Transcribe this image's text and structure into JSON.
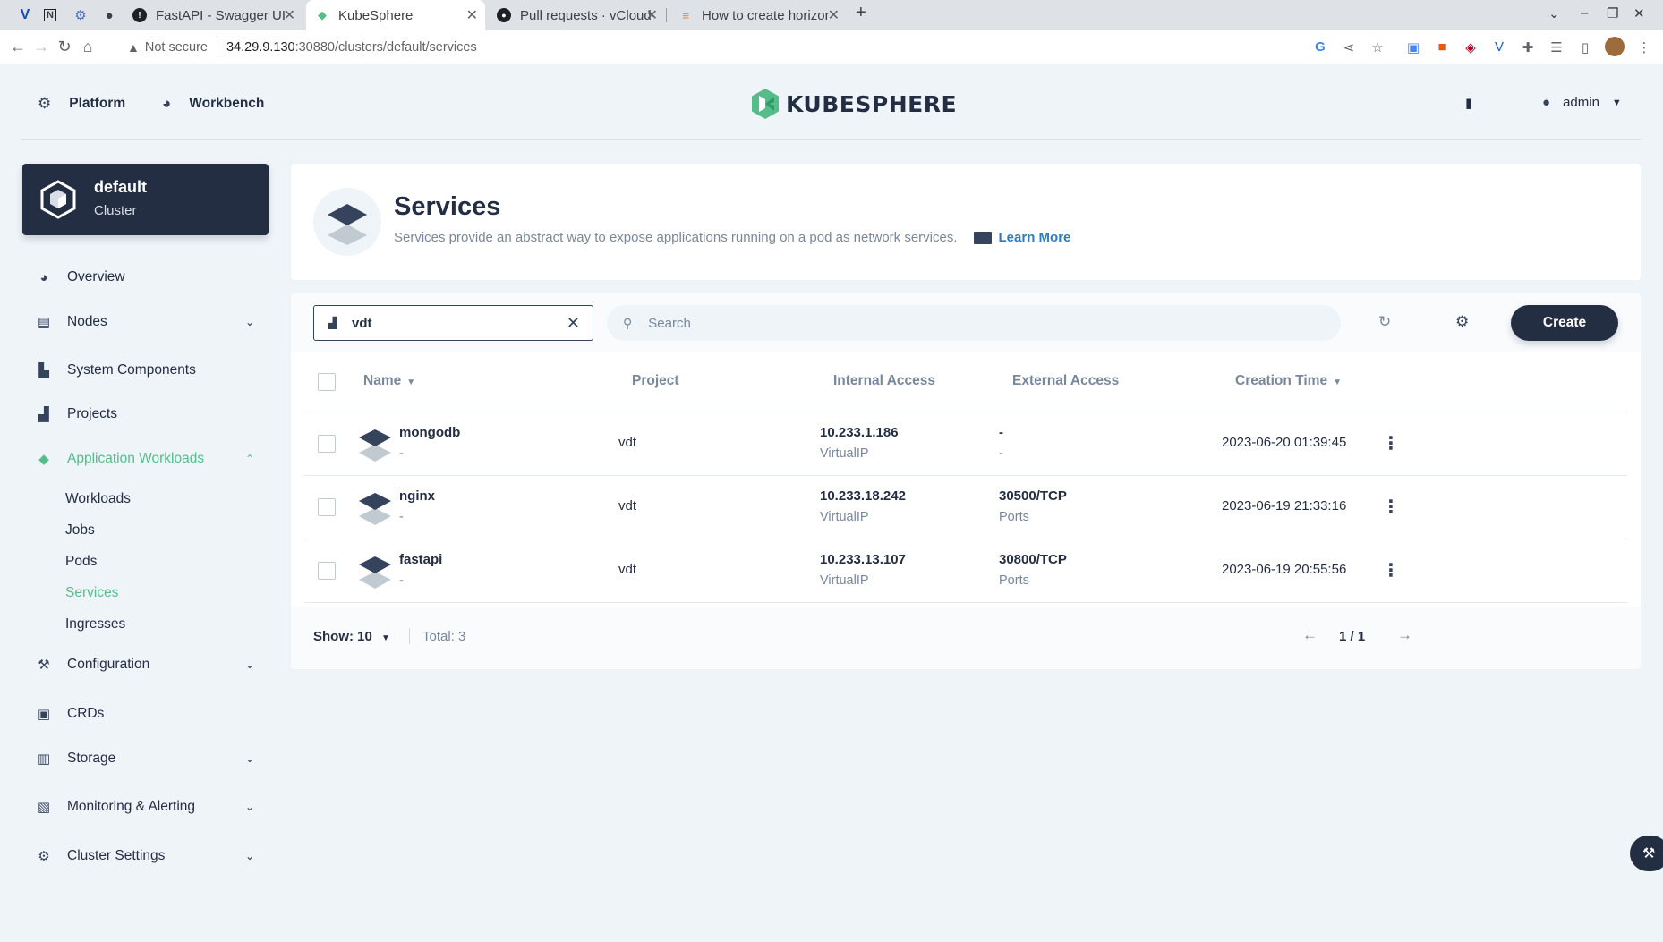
{
  "browser": {
    "tabs": [
      {
        "label": "FastAPI - Swagger UI",
        "icon": "swagger-icon"
      },
      {
        "label": "KubeSphere",
        "icon": "kubesphere-icon"
      },
      {
        "label": "Pull requests · vCloud-DF",
        "icon": "github-icon"
      },
      {
        "label": "How to create horizontal",
        "icon": "stackoverflow-icon"
      }
    ],
    "not_secure": "Not secure",
    "url_host": "34.29.9.130",
    "url_path": ":30880/clusters/default/services"
  },
  "header": {
    "platform": "Platform",
    "workbench": "Workbench",
    "logo_text": "KUBESPHERE",
    "user": "admin"
  },
  "cluster": {
    "name": "default",
    "type": "Cluster"
  },
  "sidebar": {
    "items": [
      {
        "label": "Overview",
        "icon": "dashboard-icon"
      },
      {
        "label": "Nodes",
        "icon": "nodes-icon"
      },
      {
        "label": "System Components",
        "icon": "components-icon"
      },
      {
        "label": "Projects",
        "icon": "projects-icon"
      },
      {
        "label": "Application Workloads",
        "icon": "appcenter-icon"
      },
      {
        "label": "Configuration",
        "icon": "hammer-icon"
      },
      {
        "label": "CRDs",
        "icon": "crd-icon"
      },
      {
        "label": "Storage",
        "icon": "storage-icon"
      },
      {
        "label": "Monitoring & Alerting",
        "icon": "monitor-icon"
      },
      {
        "label": "Cluster Settings",
        "icon": "gear-icon"
      }
    ],
    "sub_items": [
      "Workloads",
      "Jobs",
      "Pods",
      "Services",
      "Ingresses"
    ]
  },
  "banner": {
    "title": "Services",
    "description": "Services provide an abstract way to expose applications running on a pod as network services.",
    "learn_more": "Learn More"
  },
  "toolbar": {
    "project_filter": "vdt",
    "search_placeholder": "Search",
    "create_label": "Create"
  },
  "table": {
    "columns": {
      "name": "Name",
      "project": "Project",
      "internal": "Internal Access",
      "external": "External Access",
      "created": "Creation Time"
    },
    "rows": [
      {
        "name": "mongodb",
        "desc": "-",
        "project": "vdt",
        "internal_ip": "10.233.1.186",
        "internal_type": "VirtualIP",
        "external": "-",
        "external_sub": "-",
        "created": "2023-06-20 01:39:45"
      },
      {
        "name": "nginx",
        "desc": "-",
        "project": "vdt",
        "internal_ip": "10.233.18.242",
        "internal_type": "VirtualIP",
        "external": "30500/TCP",
        "external_sub": "Ports",
        "created": "2023-06-19 21:33:16"
      },
      {
        "name": "fastapi",
        "desc": "-",
        "project": "vdt",
        "internal_ip": "10.233.13.107",
        "internal_type": "VirtualIP",
        "external": "30800/TCP",
        "external_sub": "Ports",
        "created": "2023-06-19 20:55:56"
      }
    ]
  },
  "footer": {
    "show": "Show: 10",
    "total": "Total: 3",
    "page": "1 / 1"
  },
  "colors": {
    "accent": "#55bc8a",
    "dark": "#242e42",
    "background": "#eff4f9"
  }
}
